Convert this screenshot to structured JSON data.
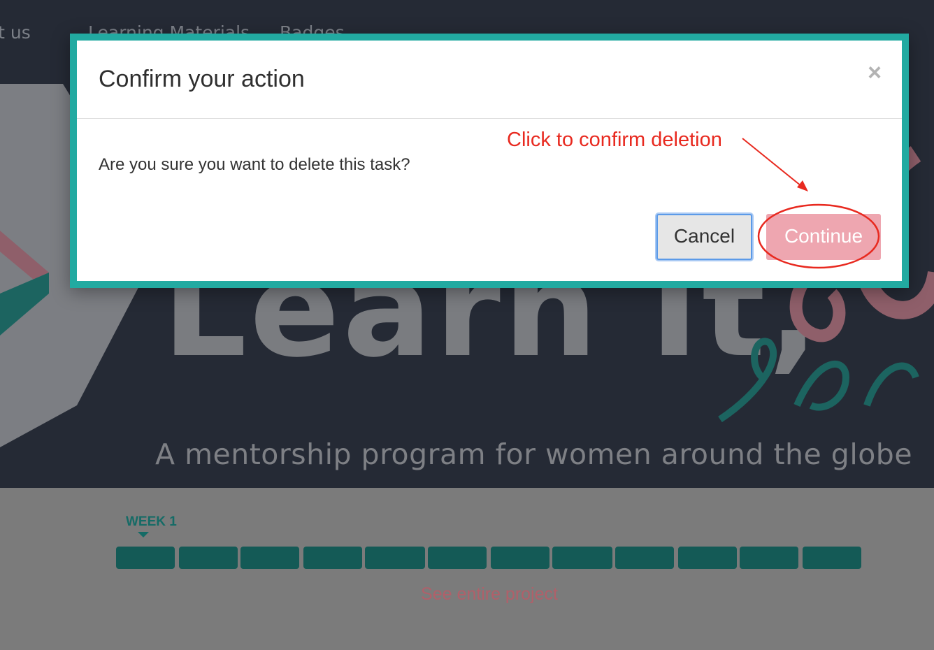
{
  "nav": {
    "about": "out us",
    "learning": "Learning Materials",
    "badges": "Badges"
  },
  "hero": {
    "title": "Learn It,",
    "tagline": "A mentorship program for women around the globe"
  },
  "progress": {
    "week_label": "WEEK 1",
    "week_count": 12,
    "see_project": "See entire project"
  },
  "modal": {
    "title": "Confirm your action",
    "close_glyph": "×",
    "question": "Are you sure you want to delete this task?",
    "cancel_label": "Cancel",
    "continue_label": "Continue"
  },
  "annotation": {
    "text": "Click to confirm deletion",
    "color": "#e8291f"
  },
  "colors": {
    "frame_accent": "#22aaa1",
    "continue_button": "#eea6b0",
    "week_bar": "#145a56"
  }
}
